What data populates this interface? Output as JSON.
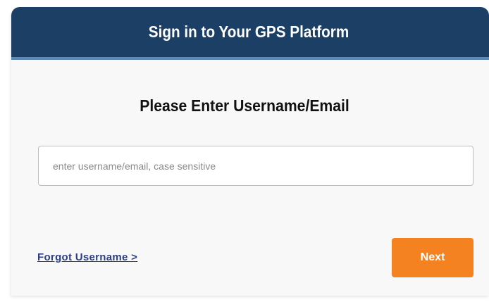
{
  "header": {
    "title": "Sign in to Your GPS Platform"
  },
  "form": {
    "prompt": "Please Enter Username/Email",
    "username_value": "",
    "username_placeholder": "enter username/email, case sensitive",
    "forgot_label": "Forgot Username >",
    "next_label": "Next"
  },
  "colors": {
    "header_bg": "#1c3f66",
    "header_underline": "#5f86b8",
    "accent": "#f58220",
    "link": "#2b3f86"
  }
}
